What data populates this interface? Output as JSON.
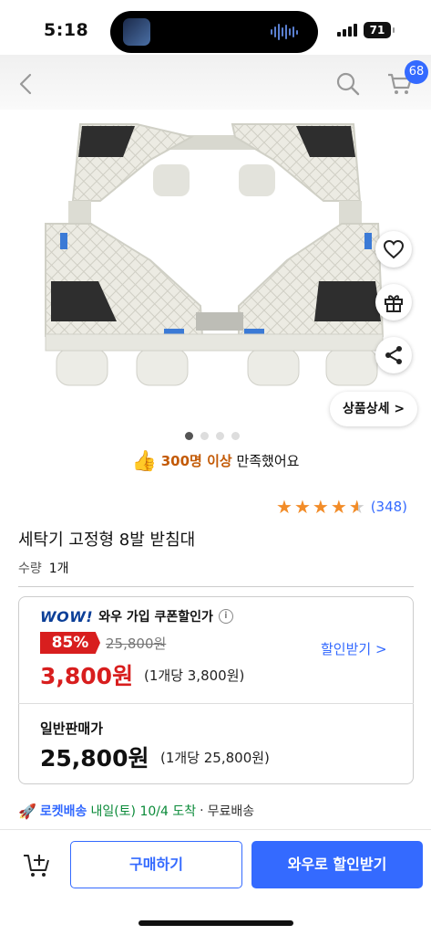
{
  "status_bar": {
    "time": "5:18",
    "battery": "71"
  },
  "nav": {
    "back_icon": "chevron-left-icon",
    "search_icon": "search-icon",
    "cart_icon": "cart-icon",
    "cart_badge": "68"
  },
  "gallery": {
    "image_count": 4,
    "active_index": 0,
    "detail_button": "상품상세 >"
  },
  "satisfaction": {
    "highlight": "300명 이상",
    "rest": " 만족했어요"
  },
  "rating": {
    "stars": 4.5,
    "reviews": "(348)"
  },
  "product": {
    "title": "세탁기 고정형 8발 받침대",
    "qty_label": "수량",
    "qty_value": "1개"
  },
  "wow": {
    "logo": "WOW!",
    "label": "와우 가입 쿠폰할인가",
    "discount": "85%",
    "original_price": "25,800원",
    "sale_price": "3,800원",
    "unit_price": "(1개당 3,800원)",
    "get_discount": "할인받기 >"
  },
  "normal": {
    "label": "일반판매가",
    "price": "25,800원",
    "unit_price": "(1개당 25,800원)"
  },
  "delivery": {
    "rocket": "로켓배송",
    "arrive": "내일(토) 10/4 도착",
    "separator": "·",
    "free": "무료배송"
  },
  "bottom": {
    "buy": "구매하기",
    "wow_buy": "와우로 할인받기"
  },
  "colors": {
    "accent": "#346aff",
    "sale": "#d81e1e",
    "arrive": "#0a8a38",
    "star": "#f28c28"
  }
}
